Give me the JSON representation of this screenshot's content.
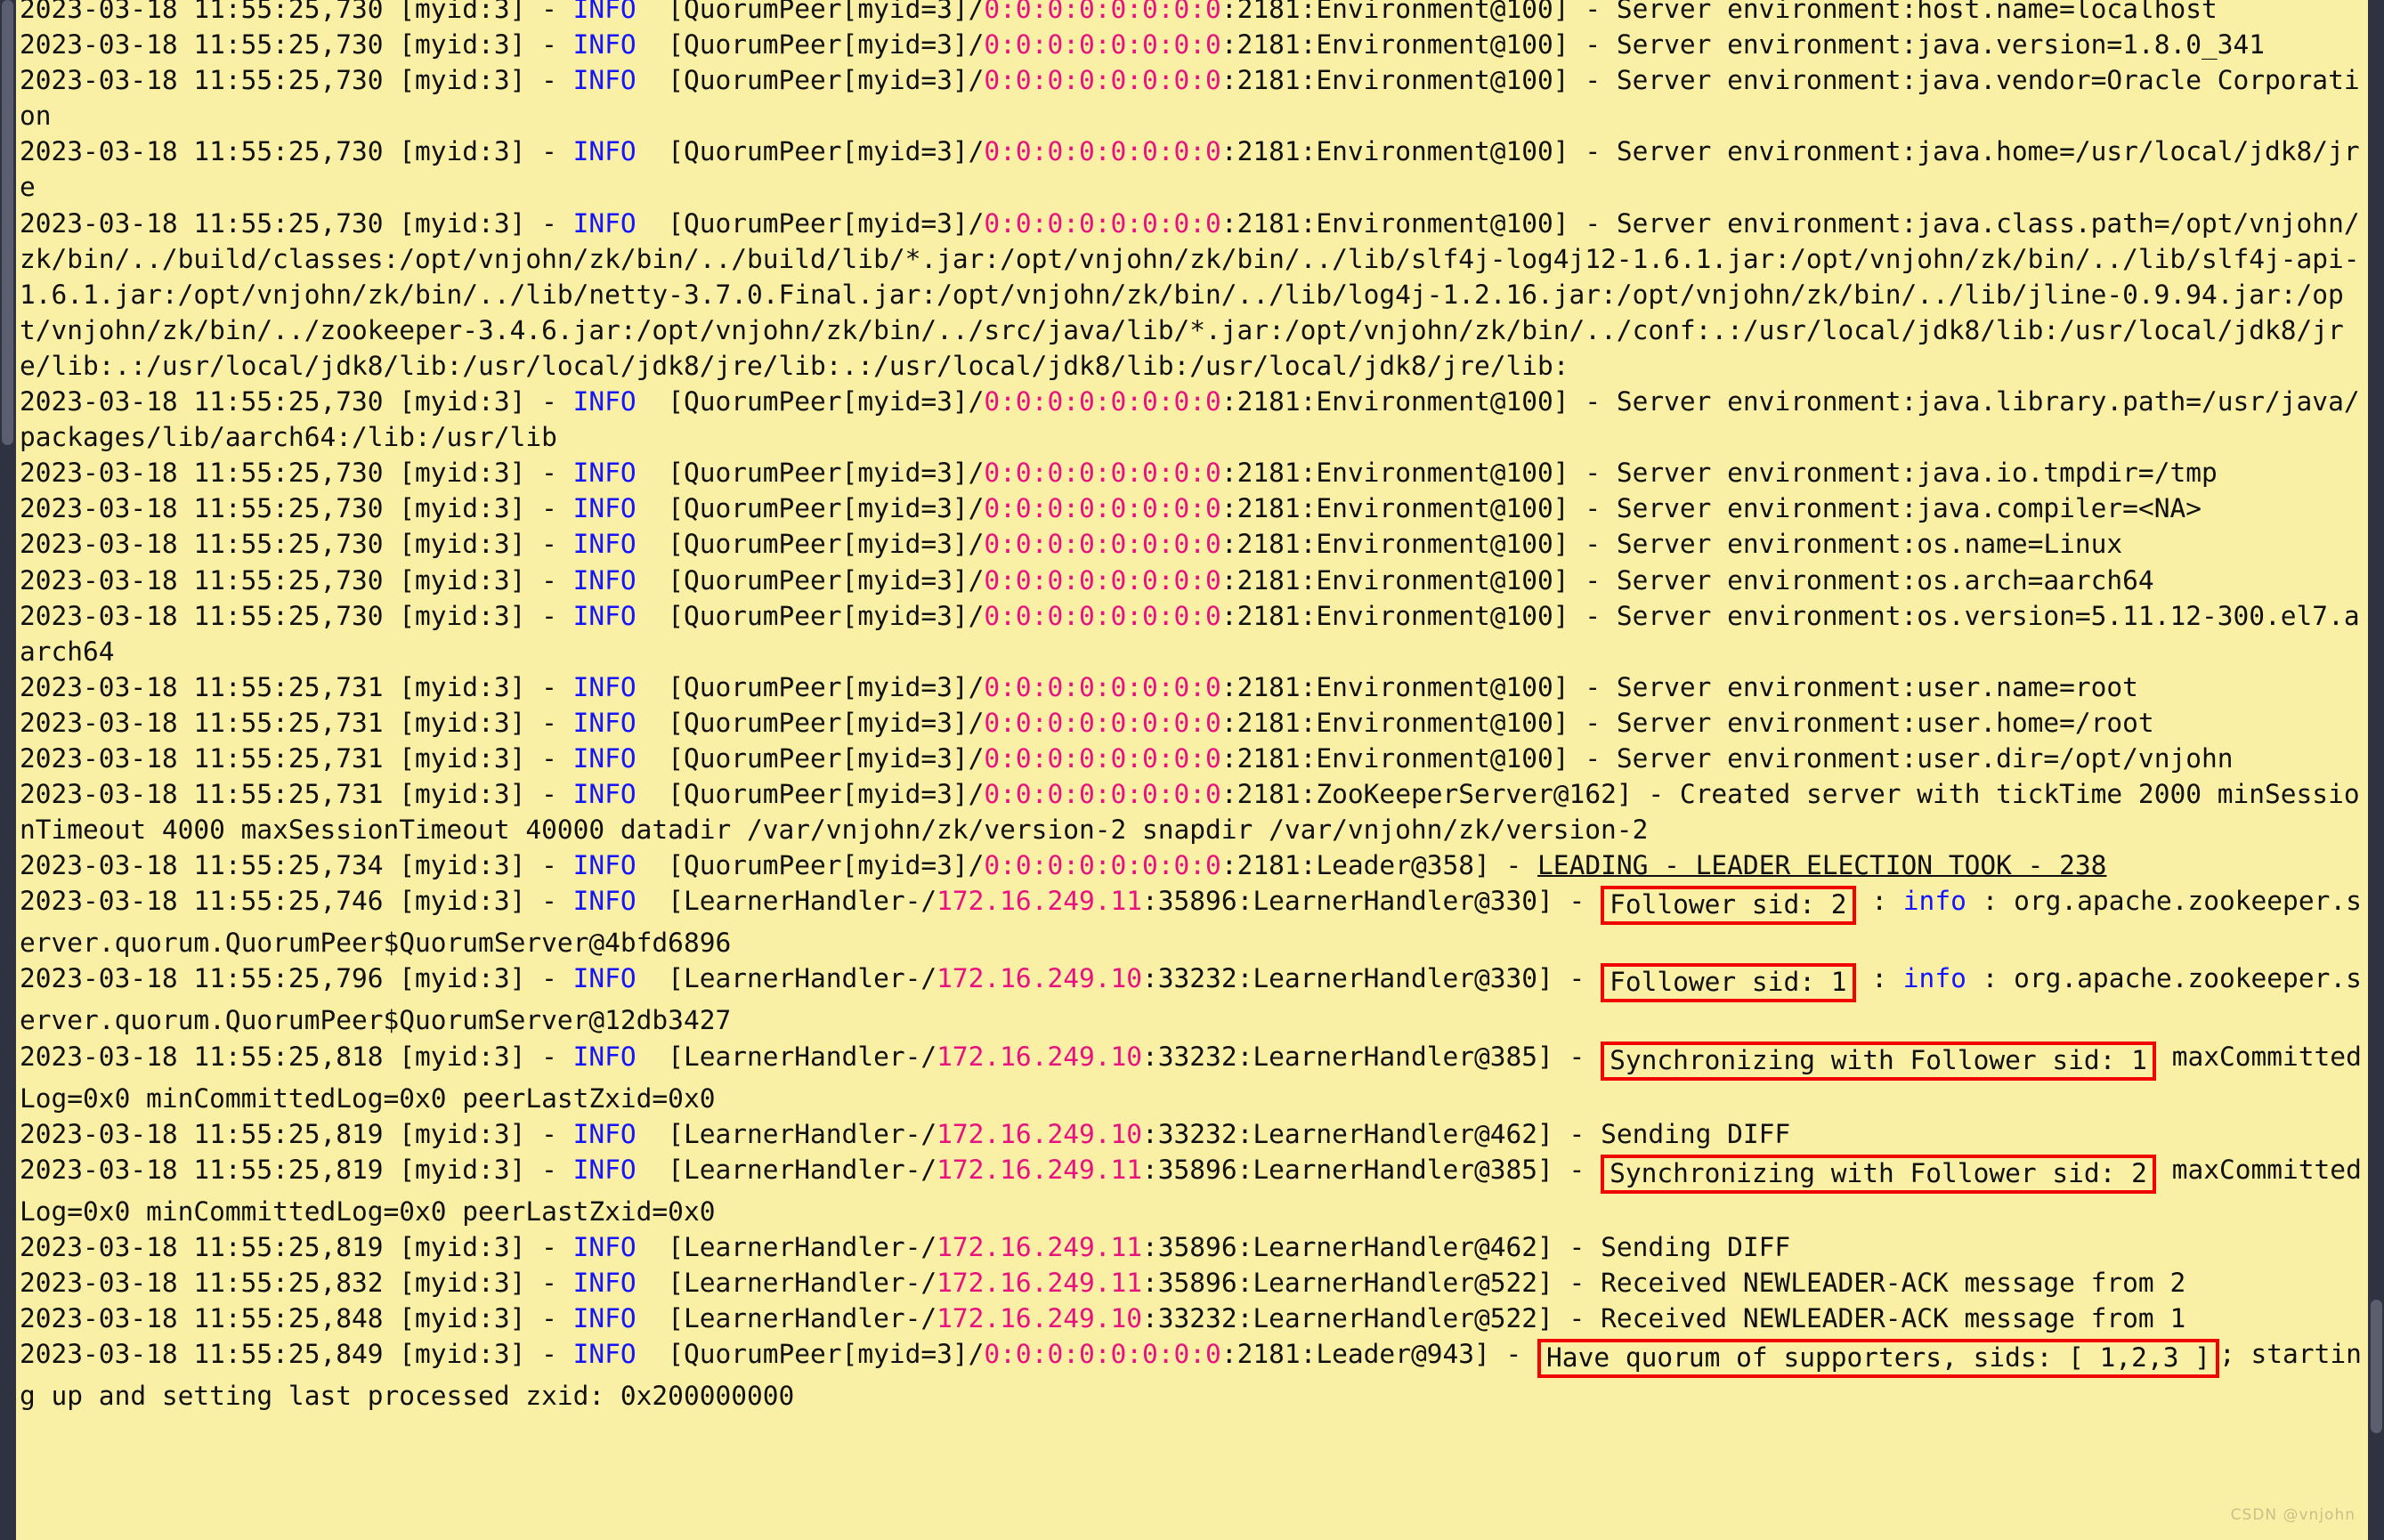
{
  "window": {
    "title": "ZooKeeper server log output",
    "background_color": "#faf0a5",
    "text_color": "#101010",
    "info_color": "#1414ff",
    "address_color": "#e8117f",
    "highlight_border_color": "#f00500",
    "gutter_color": "#2f3240"
  },
  "watermark": "CSDN @vnjohn",
  "log": {
    "lines": [
      {
        "id": "line-0",
        "truncated_top": true,
        "segments": [
          {
            "t": "2023-03-18 11:55:25,730 [myid:3] - ",
            "c": "plain"
          },
          {
            "t": "INFO",
            "c": "info"
          },
          {
            "t": "  [QuorumPeer[myid=3]/",
            "c": "plain"
          },
          {
            "t": "0:0:0:0:0:0:0:0",
            "c": "addr"
          },
          {
            "t": ":2181:Environment@100] - Server environment:host.name=localhost",
            "c": "plain"
          }
        ]
      },
      {
        "id": "line-1",
        "segments": [
          {
            "t": "2023-03-18 11:55:25,730 [myid:3] - ",
            "c": "plain"
          },
          {
            "t": "INFO",
            "c": "info"
          },
          {
            "t": "  [QuorumPeer[myid=3]/",
            "c": "plain"
          },
          {
            "t": "0:0:0:0:0:0:0:0",
            "c": "addr"
          },
          {
            "t": ":2181:Environment@100] - Server environment:java.version=1.8.0_341",
            "c": "plain"
          }
        ]
      },
      {
        "id": "line-2",
        "segments": [
          {
            "t": "2023-03-18 11:55:25,730 [myid:3] - ",
            "c": "plain"
          },
          {
            "t": "INFO",
            "c": "info"
          },
          {
            "t": "  [QuorumPeer[myid=3]/",
            "c": "plain"
          },
          {
            "t": "0:0:0:0:0:0:0:0",
            "c": "addr"
          },
          {
            "t": ":2181:Environment@100] - Server environment:java.vendor=Oracle Corporation",
            "c": "plain"
          }
        ]
      },
      {
        "id": "line-3",
        "segments": [
          {
            "t": "2023-03-18 11:55:25,730 [myid:3] - ",
            "c": "plain"
          },
          {
            "t": "INFO",
            "c": "info"
          },
          {
            "t": "  [QuorumPeer[myid=3]/",
            "c": "plain"
          },
          {
            "t": "0:0:0:0:0:0:0:0",
            "c": "addr"
          },
          {
            "t": ":2181:Environment@100] - Server environment:java.home=/usr/local/jdk8/jre",
            "c": "plain"
          }
        ]
      },
      {
        "id": "line-4",
        "segments": [
          {
            "t": "2023-03-18 11:55:25,730 [myid:3] - ",
            "c": "plain"
          },
          {
            "t": "INFO",
            "c": "info"
          },
          {
            "t": "  [QuorumPeer[myid=3]/",
            "c": "plain"
          },
          {
            "t": "0:0:0:0:0:0:0:0",
            "c": "addr"
          },
          {
            "t": ":2181:Environment@100] - Server environment:java.class.path=/opt/vnjohn/zk/bin/../build/classes:/opt/vnjohn/zk/bin/../build/lib/*.jar:/opt/vnjohn/zk/bin/../lib/slf4j-log4j12-1.6.1.jar:/opt/vnjohn/zk/bin/../lib/slf4j-api-1.6.1.jar:/opt/vnjohn/zk/bin/../lib/netty-3.7.0.Final.jar:/opt/vnjohn/zk/bin/../lib/log4j-1.2.16.jar:/opt/vnjohn/zk/bin/../lib/jline-0.9.94.jar:/opt/vnjohn/zk/bin/../zookeeper-3.4.6.jar:/opt/vnjohn/zk/bin/../src/java/lib/*.jar:/opt/vnjohn/zk/bin/../conf:.:/usr/local/jdk8/lib:/usr/local/jdk8/jre/lib:.:/usr/local/jdk8/lib:/usr/local/jdk8/jre/lib:.:/usr/local/jdk8/lib:/usr/local/jdk8/jre/lib:",
            "c": "plain"
          }
        ]
      },
      {
        "id": "line-5",
        "segments": [
          {
            "t": "2023-03-18 11:55:25,730 [myid:3] - ",
            "c": "plain"
          },
          {
            "t": "INFO",
            "c": "info"
          },
          {
            "t": "  [QuorumPeer[myid=3]/",
            "c": "plain"
          },
          {
            "t": "0:0:0:0:0:0:0:0",
            "c": "addr"
          },
          {
            "t": ":2181:Environment@100] - Server environment:java.library.path=/usr/java/packages/lib/aarch64:/lib:/usr/lib",
            "c": "plain"
          }
        ]
      },
      {
        "id": "line-6",
        "segments": [
          {
            "t": "2023-03-18 11:55:25,730 [myid:3] - ",
            "c": "plain"
          },
          {
            "t": "INFO",
            "c": "info"
          },
          {
            "t": "  [QuorumPeer[myid=3]/",
            "c": "plain"
          },
          {
            "t": "0:0:0:0:0:0:0:0",
            "c": "addr"
          },
          {
            "t": ":2181:Environment@100] - Server environment:java.io.tmpdir=/tmp",
            "c": "plain"
          }
        ]
      },
      {
        "id": "line-7",
        "segments": [
          {
            "t": "2023-03-18 11:55:25,730 [myid:3] - ",
            "c": "plain"
          },
          {
            "t": "INFO",
            "c": "info"
          },
          {
            "t": "  [QuorumPeer[myid=3]/",
            "c": "plain"
          },
          {
            "t": "0:0:0:0:0:0:0:0",
            "c": "addr"
          },
          {
            "t": ":2181:Environment@100] - Server environment:java.compiler=<NA>",
            "c": "plain"
          }
        ]
      },
      {
        "id": "line-8",
        "segments": [
          {
            "t": "2023-03-18 11:55:25,730 [myid:3] - ",
            "c": "plain"
          },
          {
            "t": "INFO",
            "c": "info"
          },
          {
            "t": "  [QuorumPeer[myid=3]/",
            "c": "plain"
          },
          {
            "t": "0:0:0:0:0:0:0:0",
            "c": "addr"
          },
          {
            "t": ":2181:Environment@100] - Server environment:os.name=Linux",
            "c": "plain"
          }
        ]
      },
      {
        "id": "line-9",
        "segments": [
          {
            "t": "2023-03-18 11:55:25,730 [myid:3] - ",
            "c": "plain"
          },
          {
            "t": "INFO",
            "c": "info"
          },
          {
            "t": "  [QuorumPeer[myid=3]/",
            "c": "plain"
          },
          {
            "t": "0:0:0:0:0:0:0:0",
            "c": "addr"
          },
          {
            "t": ":2181:Environment@100] - Server environment:os.arch=aarch64",
            "c": "plain"
          }
        ]
      },
      {
        "id": "line-10",
        "segments": [
          {
            "t": "2023-03-18 11:55:25,730 [myid:3] - ",
            "c": "plain"
          },
          {
            "t": "INFO",
            "c": "info"
          },
          {
            "t": "  [QuorumPeer[myid=3]/",
            "c": "plain"
          },
          {
            "t": "0:0:0:0:0:0:0:0",
            "c": "addr"
          },
          {
            "t": ":2181:Environment@100] - Server environment:os.version=5.11.12-300.el7.aarch64",
            "c": "plain"
          }
        ]
      },
      {
        "id": "line-11",
        "segments": [
          {
            "t": "2023-03-18 11:55:25,731 [myid:3] - ",
            "c": "plain"
          },
          {
            "t": "INFO",
            "c": "info"
          },
          {
            "t": "  [QuorumPeer[myid=3]/",
            "c": "plain"
          },
          {
            "t": "0:0:0:0:0:0:0:0",
            "c": "addr"
          },
          {
            "t": ":2181:Environment@100] - Server environment:user.name=root",
            "c": "plain"
          }
        ]
      },
      {
        "id": "line-12",
        "segments": [
          {
            "t": "2023-03-18 11:55:25,731 [myid:3] - ",
            "c": "plain"
          },
          {
            "t": "INFO",
            "c": "info"
          },
          {
            "t": "  [QuorumPeer[myid=3]/",
            "c": "plain"
          },
          {
            "t": "0:0:0:0:0:0:0:0",
            "c": "addr"
          },
          {
            "t": ":2181:Environment@100] - Server environment:user.home=/root",
            "c": "plain"
          }
        ]
      },
      {
        "id": "line-13",
        "segments": [
          {
            "t": "2023-03-18 11:55:25,731 [myid:3] - ",
            "c": "plain"
          },
          {
            "t": "INFO",
            "c": "info"
          },
          {
            "t": "  [QuorumPeer[myid=3]/",
            "c": "plain"
          },
          {
            "t": "0:0:0:0:0:0:0:0",
            "c": "addr"
          },
          {
            "t": ":2181:Environment@100] - Server environment:user.dir=/opt/vnjohn",
            "c": "plain"
          }
        ]
      },
      {
        "id": "line-14",
        "segments": [
          {
            "t": "2023-03-18 11:55:25,731 [myid:3] - ",
            "c": "plain"
          },
          {
            "t": "INFO",
            "c": "info"
          },
          {
            "t": "  [QuorumPeer[myid=3]/",
            "c": "plain"
          },
          {
            "t": "0:0:0:0:0:0:0:0",
            "c": "addr"
          },
          {
            "t": ":2181:ZooKeeperServer@162] - Created server with tickTime 2000 minSessionTimeout 4000 maxSessionTimeout 40000 datadir /var/vnjohn/zk/version-2 snapdir /var/vnjohn/zk/version-2",
            "c": "plain"
          }
        ]
      },
      {
        "id": "line-15",
        "segments": [
          {
            "t": "2023-03-18 11:55:25,734 [myid:3] - ",
            "c": "plain"
          },
          {
            "t": "INFO",
            "c": "info"
          },
          {
            "t": "  [QuorumPeer[myid=3]/",
            "c": "plain"
          },
          {
            "t": "0:0:0:0:0:0:0:0",
            "c": "addr"
          },
          {
            "t": ":2181:Leader@358] - ",
            "c": "plain"
          },
          {
            "t": "LEADING - LEADER ELECTION TOOK - 238",
            "c": "underline"
          }
        ]
      },
      {
        "id": "line-16",
        "segments": [
          {
            "t": "2023-03-18 11:55:25,746 [myid:3] - ",
            "c": "plain"
          },
          {
            "t": "INFO",
            "c": "info"
          },
          {
            "t": "  [LearnerHandler-/",
            "c": "plain"
          },
          {
            "t": "172.16.249.11",
            "c": "addr"
          },
          {
            "t": ":35896:LearnerHandler@330] - ",
            "c": "plain"
          },
          {
            "t": "Follower sid: 2",
            "c": "box"
          },
          {
            "t": " : ",
            "c": "plain"
          },
          {
            "t": "info",
            "c": "info"
          },
          {
            "t": " : org.apache.zookeeper.server.quorum.QuorumPeer$QuorumServer@4bfd6896",
            "c": "plain"
          }
        ]
      },
      {
        "id": "line-17",
        "segments": [
          {
            "t": "2023-03-18 11:55:25,796 [myid:3] - ",
            "c": "plain"
          },
          {
            "t": "INFO",
            "c": "info"
          },
          {
            "t": "  [LearnerHandler-/",
            "c": "plain"
          },
          {
            "t": "172.16.249.10",
            "c": "addr"
          },
          {
            "t": ":33232:LearnerHandler@330] - ",
            "c": "plain"
          },
          {
            "t": "Follower sid: 1",
            "c": "box"
          },
          {
            "t": " : ",
            "c": "plain"
          },
          {
            "t": "info",
            "c": "info"
          },
          {
            "t": " : org.apache.zookeeper.server.quorum.QuorumPeer$QuorumServer@12db3427",
            "c": "plain"
          }
        ]
      },
      {
        "id": "line-18",
        "segments": [
          {
            "t": "2023-03-18 11:55:25,818 [myid:3] - ",
            "c": "plain"
          },
          {
            "t": "INFO",
            "c": "info"
          },
          {
            "t": "  [LearnerHandler-/",
            "c": "plain"
          },
          {
            "t": "172.16.249.10",
            "c": "addr"
          },
          {
            "t": ":33232:LearnerHandler@385] - ",
            "c": "plain"
          },
          {
            "t": "Synchronizing with Follower sid: 1",
            "c": "box"
          },
          {
            "t": " maxCommittedLog=0x0 minCommittedLog=0x0 peerLastZxid=0x0",
            "c": "plain"
          }
        ]
      },
      {
        "id": "line-19",
        "segments": [
          {
            "t": "2023-03-18 11:55:25,819 [myid:3] - ",
            "c": "plain"
          },
          {
            "t": "INFO",
            "c": "info"
          },
          {
            "t": "  [LearnerHandler-/",
            "c": "plain"
          },
          {
            "t": "172.16.249.10",
            "c": "addr"
          },
          {
            "t": ":33232:LearnerHandler@462] - Sending DIFF",
            "c": "plain"
          }
        ]
      },
      {
        "id": "line-20",
        "segments": [
          {
            "t": "2023-03-18 11:55:25,819 [myid:3] - ",
            "c": "plain"
          },
          {
            "t": "INFO",
            "c": "info"
          },
          {
            "t": "  [LearnerHandler-/",
            "c": "plain"
          },
          {
            "t": "172.16.249.11",
            "c": "addr"
          },
          {
            "t": ":35896:LearnerHandler@385] - ",
            "c": "plain"
          },
          {
            "t": "Synchronizing with Follower sid: 2",
            "c": "box"
          },
          {
            "t": " maxCommittedLog=0x0 minCommittedLog=0x0 peerLastZxid=0x0",
            "c": "plain"
          }
        ]
      },
      {
        "id": "line-21",
        "segments": [
          {
            "t": "2023-03-18 11:55:25,819 [myid:3] - ",
            "c": "plain"
          },
          {
            "t": "INFO",
            "c": "info"
          },
          {
            "t": "  [LearnerHandler-/",
            "c": "plain"
          },
          {
            "t": "172.16.249.11",
            "c": "addr"
          },
          {
            "t": ":35896:LearnerHandler@462] - Sending DIFF",
            "c": "plain"
          }
        ]
      },
      {
        "id": "line-22",
        "segments": [
          {
            "t": "2023-03-18 11:55:25,832 [myid:3] - ",
            "c": "plain"
          },
          {
            "t": "INFO",
            "c": "info"
          },
          {
            "t": "  [LearnerHandler-/",
            "c": "plain"
          },
          {
            "t": "172.16.249.11",
            "c": "addr"
          },
          {
            "t": ":35896:LearnerHandler@522] - Received NEWLEADER-ACK message from 2",
            "c": "plain"
          }
        ]
      },
      {
        "id": "line-23",
        "segments": [
          {
            "t": "2023-03-18 11:55:25,848 [myid:3] - ",
            "c": "plain"
          },
          {
            "t": "INFO",
            "c": "info"
          },
          {
            "t": "  [LearnerHandler-/",
            "c": "plain"
          },
          {
            "t": "172.16.249.10",
            "c": "addr"
          },
          {
            "t": ":33232:LearnerHandler@522] - Received NEWLEADER-ACK message from 1",
            "c": "plain"
          }
        ]
      },
      {
        "id": "line-24",
        "segments": [
          {
            "t": "2023-03-18 11:55:25,849 [myid:3] - ",
            "c": "plain"
          },
          {
            "t": "INFO",
            "c": "info"
          },
          {
            "t": "  [QuorumPeer[myid=3]/",
            "c": "plain"
          },
          {
            "t": "0:0:0:0:0:0:0:0",
            "c": "addr"
          },
          {
            "t": ":2181:Leader@943] - ",
            "c": "plain"
          },
          {
            "t": "Have quorum of supporters, sids: [ 1,2,3 ]",
            "c": "box"
          },
          {
            "t": "; starting up and setting last processed zxid: 0x200000000",
            "c": "plain"
          }
        ]
      }
    ]
  }
}
